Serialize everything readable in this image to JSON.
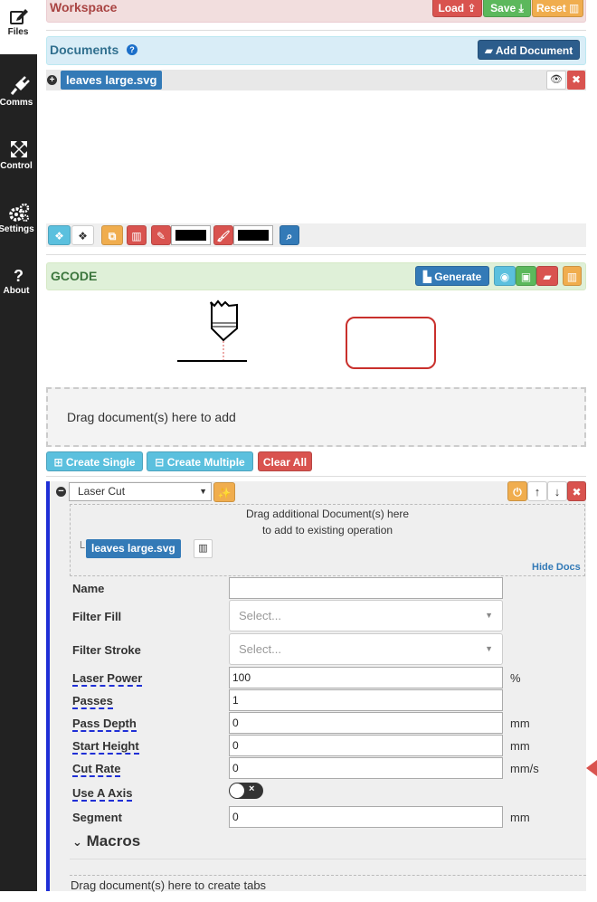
{
  "sidebar": {
    "items": [
      {
        "label": "Files",
        "icon": "edit-icon"
      },
      {
        "label": "Comms",
        "icon": "plug-icon"
      },
      {
        "label": "Control",
        "icon": "arrows-icon"
      },
      {
        "label": "Settings",
        "icon": "gears-icon"
      },
      {
        "label": "About",
        "icon": "question-icon"
      }
    ]
  },
  "workspace": {
    "title": "Workspace",
    "load_label": "Load",
    "save_label": "Save",
    "reset_label": "Reset"
  },
  "documents": {
    "title": "Documents",
    "add_label": "Add Document",
    "file_name": "leaves large.svg",
    "fill_color": "#000000",
    "stroke_color": "#000000"
  },
  "gcode": {
    "title": "GCODE",
    "generate_label": "Generate",
    "drop_text": "Drag document(s) here to add",
    "create_single_label": "Create Single",
    "create_multiple_label": "Create Multiple",
    "clear_all_label": "Clear All"
  },
  "operation": {
    "type": "Laser Cut",
    "drop_line1": "Drag additional Document(s) here",
    "drop_line2": "to add to existing operation",
    "doc_name": "leaves large.svg",
    "hide_docs_label": "Hide Docs",
    "fields": {
      "name": {
        "label": "Name",
        "value": ""
      },
      "filter_fill": {
        "label": "Filter Fill",
        "placeholder": "Select..."
      },
      "filter_stroke": {
        "label": "Filter Stroke",
        "placeholder": "Select..."
      },
      "laser_power": {
        "label": "Laser Power",
        "value": "100",
        "unit": "%"
      },
      "passes": {
        "label": "Passes",
        "value": "1"
      },
      "pass_depth": {
        "label": "Pass Depth",
        "value": "0",
        "unit": "mm"
      },
      "start_height": {
        "label": "Start Height",
        "value": "0",
        "unit": "mm"
      },
      "cut_rate": {
        "label": "Cut Rate",
        "value": "0",
        "unit": "mm/s"
      },
      "use_a_axis": {
        "label": "Use A Axis"
      },
      "segment": {
        "label": "Segment",
        "value": "0",
        "unit": "mm"
      }
    },
    "macros_label": "Macros",
    "tabs_drop_text": "Drag document(s) here to create tabs"
  },
  "colors": {
    "sidebar_bg": "#222222",
    "danger": "#d9534f",
    "success": "#5cb85c",
    "warning": "#f0ad4e",
    "primary": "#337ab7",
    "info": "#5bc0de",
    "operation_accent": "#1f2fd6"
  }
}
